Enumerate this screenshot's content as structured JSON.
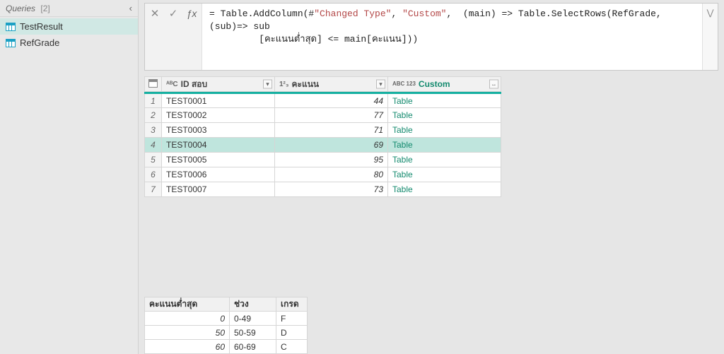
{
  "sidebar": {
    "title": "Queries",
    "count": "[2]",
    "items": [
      {
        "label": "TestResult"
      },
      {
        "label": "RefGrade"
      }
    ]
  },
  "formula": {
    "prefix": "= Table.AddColumn(#",
    "str1": "\"Changed Type\"",
    "mid1": ", ",
    "str2": "\"Custom\"",
    "mid2": ",  (main) => Table.SelectRows(RefGrade, (sub)=> sub",
    "line2": "         [คะแนนต่ำสุด] <= main[คะแนน]))"
  },
  "grid": {
    "columns": {
      "id_type": "ᴬᴮC",
      "id_label": "ID สอบ",
      "score_type": "1²₃",
      "score_label": "คะแนน",
      "custom_type": "ABC\n123",
      "custom_label": "Custom"
    },
    "rows": [
      {
        "n": "1",
        "id": "TEST0001",
        "score": "44",
        "custom": "Table"
      },
      {
        "n": "2",
        "id": "TEST0002",
        "score": "77",
        "custom": "Table"
      },
      {
        "n": "3",
        "id": "TEST0003",
        "score": "71",
        "custom": "Table"
      },
      {
        "n": "4",
        "id": "TEST0004",
        "score": "69",
        "custom": "Table"
      },
      {
        "n": "5",
        "id": "TEST0005",
        "score": "95",
        "custom": "Table"
      },
      {
        "n": "6",
        "id": "TEST0006",
        "score": "80",
        "custom": "Table"
      },
      {
        "n": "7",
        "id": "TEST0007",
        "score": "73",
        "custom": "Table"
      }
    ],
    "selected_index": 3
  },
  "preview": {
    "headers": {
      "c1": "คะแนนต่ำสุด",
      "c2": "ช่วง",
      "c3": "เกรด"
    },
    "rows": [
      {
        "c1": "0",
        "c2": "0-49",
        "c3": "F"
      },
      {
        "c1": "50",
        "c2": "50-59",
        "c3": "D"
      },
      {
        "c1": "60",
        "c2": "60-69",
        "c3": "C"
      }
    ]
  }
}
